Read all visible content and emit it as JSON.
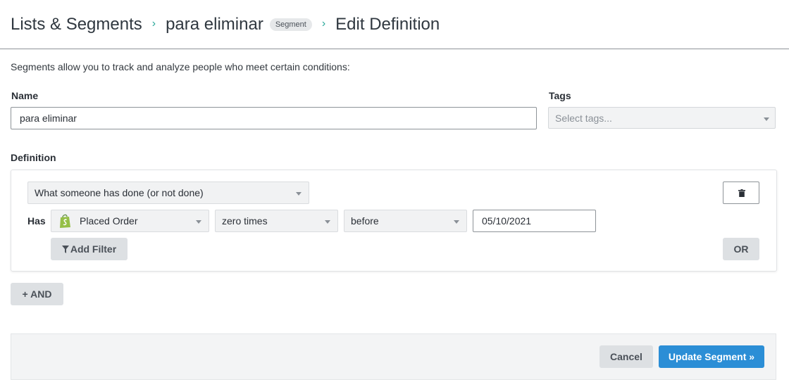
{
  "breadcrumb": {
    "root": "Lists & Segments",
    "item": "para eliminar",
    "badge": "Segment",
    "current": "Edit Definition",
    "separator": "›"
  },
  "intro_text": "Segments allow you to track and analyze people who meet certain conditions:",
  "name": {
    "label": "Name",
    "value": "para eliminar"
  },
  "tags": {
    "label": "Tags",
    "placeholder": "Select tags..."
  },
  "definition": {
    "label": "Definition",
    "condition_type": "What someone has done (or not done)",
    "has_label": "Has",
    "event": "Placed Order",
    "frequency": "zero times",
    "time_operator": "before",
    "date": "05/10/2021",
    "add_filter_label": "Add Filter",
    "or_label": "OR"
  },
  "and_button_label": "+ AND",
  "footer": {
    "cancel_label": "Cancel",
    "update_label": "Update Segment »"
  },
  "colors": {
    "accent": "#2b8ed6",
    "breadcrumb_separator": "#2aa89a",
    "shopify_green": "#95bf47"
  }
}
